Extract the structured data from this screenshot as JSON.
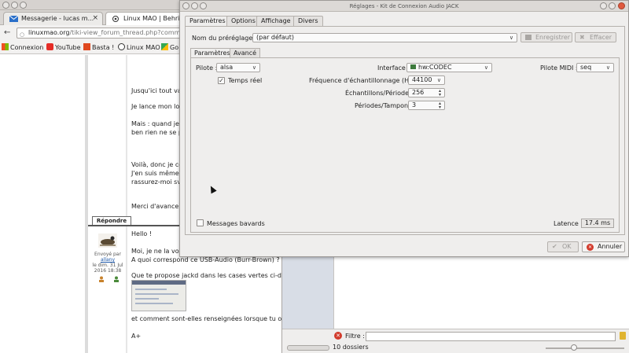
{
  "browser": {
    "tabs": [
      {
        "label": "Messagerie - lucas m...",
        "close": "×"
      },
      {
        "label": "Linux MAO | Behring"
      }
    ],
    "url": {
      "host": "linuxmao.org",
      "path": "/tiki-view_forum_thread.php?commer"
    },
    "bookmarks": [
      "Connexion",
      "YouTube",
      "Basta !",
      "Linux MAO",
      "Go"
    ],
    "post1_lines": [
      "Jusqu'ici tout va",
      "Je lance mon lo",
      "Mais : quand je",
      "ben rien ne se p",
      "Voilà, donc je co",
      "J'en suis même",
      "rassurez-moi sv",
      "Merci d'avance"
    ],
    "reply_label": "Répondre",
    "post2": {
      "meta": [
        "Envoyé par",
        "allany",
        "le dim. 31 Jul",
        "2016 18:38"
      ],
      "lines": [
        "Hello !",
        "Moi, je ne la vois",
        "A quoi correspond ce USB-Audio (Burr-Brown) ?",
        "Que te propose jackd dans les cases vertes ci-des",
        "et comment sont-elles renseignées lorsque tu obtie",
        "A+"
      ]
    }
  },
  "filemanager": {
    "filter_label": "Filtre :",
    "filter_value": "",
    "status": "10 dossiers"
  },
  "jack": {
    "title": "Réglages - Kit de Connexion Audio JACK",
    "main_tabs": [
      "Paramètres",
      "Options",
      "Affichage",
      "Divers"
    ],
    "preset": {
      "label": "Nom du préréglage :",
      "value": "(par défaut)",
      "save": "Enregistrer",
      "delete": "Effacer"
    },
    "sub_tabs": [
      "Paramètres",
      "Avancé"
    ],
    "driver": {
      "label": "Pilote :",
      "value": "alsa"
    },
    "realtime": {
      "label": "Temps réel",
      "checked": true
    },
    "interface": {
      "label": "Interface :",
      "value": "hw:CODEC"
    },
    "midi": {
      "label": "Pilote MIDI :",
      "value": "seq"
    },
    "samplerate": {
      "label": "Fréquence d'échantillonnage (Hz) :",
      "value": "44100"
    },
    "frames": {
      "label": "Échantillons/Période :",
      "value": "256"
    },
    "periods": {
      "label": "Périodes/Tampon :",
      "value": "3"
    },
    "verbose": {
      "label": "Messages bavards",
      "checked": false
    },
    "latency": {
      "label": "Latence :",
      "value": "17.4 ms"
    },
    "ok_label": "OK",
    "cancel_label": "Annuler"
  }
}
